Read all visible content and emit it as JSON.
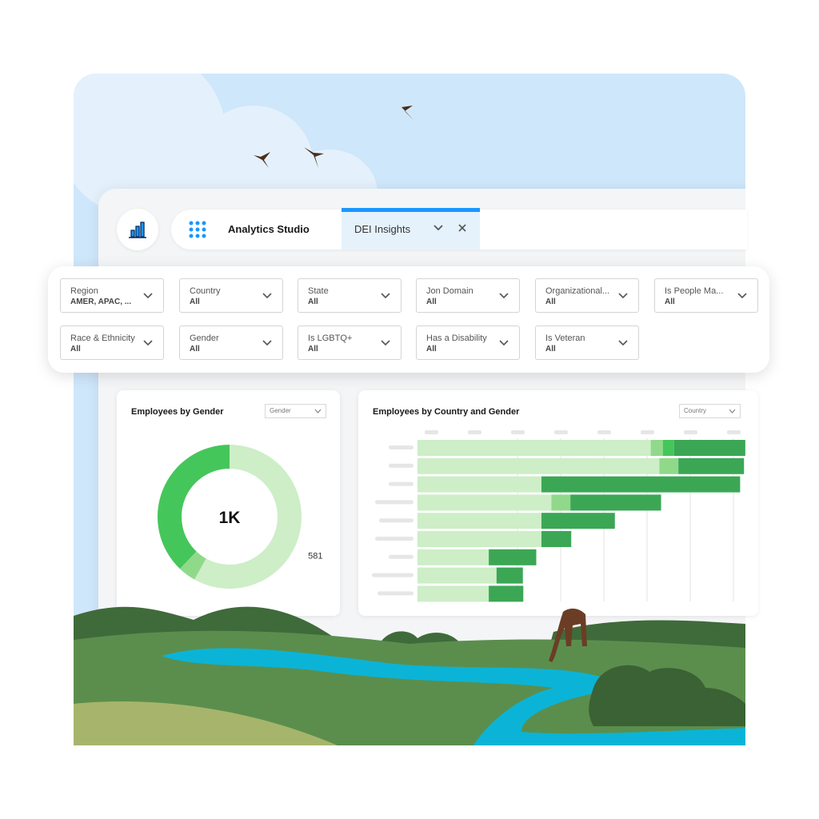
{
  "header": {
    "app_icon": "bar-chart-icon",
    "launcher_icon": "app-launcher-grid-icon",
    "app_title": "Analytics Studio",
    "tab": {
      "label": "DEI Insights",
      "active_color": "#1b96ff"
    }
  },
  "filters": [
    {
      "label": "Region",
      "value": "AMER, APAC, ..."
    },
    {
      "label": "Country",
      "value": "All"
    },
    {
      "label": "State",
      "value": "All"
    },
    {
      "label": "Jon Domain",
      "value": "All"
    },
    {
      "label": "Organizational...",
      "value": "All"
    },
    {
      "label": "Is People Ma...",
      "value": "All"
    },
    {
      "label": "Race & Ethnicity",
      "value": "All"
    },
    {
      "label": "Gender",
      "value": "All"
    },
    {
      "label": "Is LGBTQ+",
      "value": "All"
    },
    {
      "label": "Has a Disability",
      "value": "All"
    },
    {
      "label": "Is Veteran",
      "value": "All"
    }
  ],
  "chart_data": [
    {
      "type": "pie",
      "title": "Employees by Gender",
      "selector": "Gender",
      "center_label": "1K",
      "slices": [
        {
          "value": 581,
          "label": "581",
          "color": "#cdeec7"
        },
        {
          "value": 40,
          "label": "",
          "color": "#90d98a"
        },
        {
          "value": 379,
          "label": "379",
          "color": "#45c65a"
        }
      ]
    },
    {
      "type": "bar",
      "orientation": "horizontal",
      "stacked": true,
      "title": "Employees by Country and Gender",
      "selector": "Country",
      "grid": true,
      "colors": [
        "#cdeec7",
        "#90d98a",
        "#45c65a",
        "#3ba755"
      ],
      "rows": [
        [
          5.4,
          0.28,
          0.26,
          1.65
        ],
        [
          5.6,
          0.44,
          0,
          1.52
        ],
        [
          2.87,
          0,
          0,
          4.6
        ],
        [
          3.1,
          0.44,
          0,
          2.1
        ],
        [
          2.87,
          0,
          0,
          1.7
        ],
        [
          2.87,
          0,
          0,
          0.69
        ],
        [
          1.65,
          0,
          0,
          1.1
        ],
        [
          1.83,
          0,
          0,
          0.61
        ],
        [
          1.65,
          0,
          0,
          0.8
        ]
      ]
    }
  ]
}
